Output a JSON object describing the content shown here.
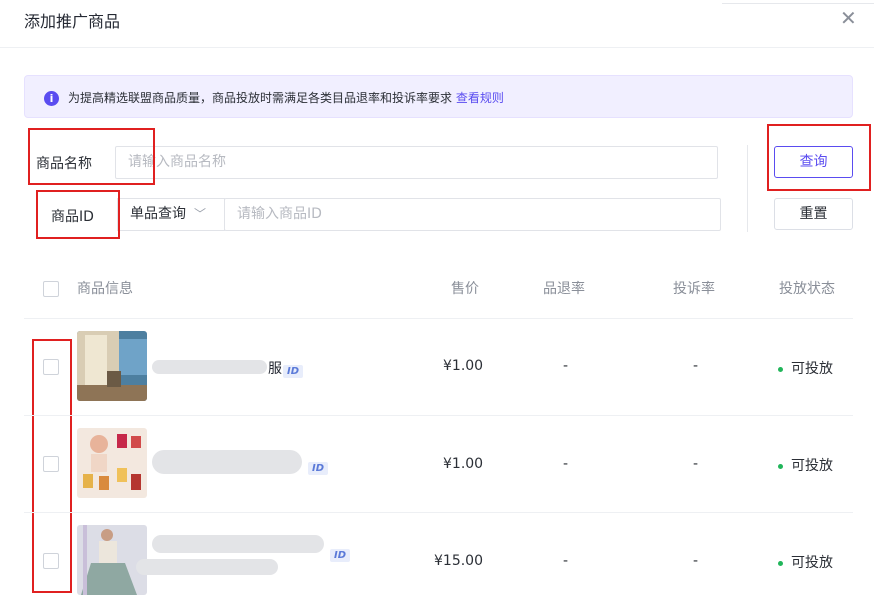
{
  "dialog": {
    "title": "添加推广商品",
    "close_icon": "close-icon"
  },
  "notice": {
    "icon": "info-icon",
    "icon_glyph": "i",
    "text": "为提高精选联盟商品质量，商品投放时需满足各类目品退率和投诉率要求",
    "link": "查看规则"
  },
  "search": {
    "name_label": "商品名称",
    "name_placeholder": "请输入商品名称",
    "id_label": "商品ID",
    "id_mode": "单品查询",
    "id_placeholder": "请输入商品ID",
    "query_button": "查询",
    "reset_button": "重置"
  },
  "table": {
    "columns": [
      "商品信息",
      "售价",
      "品退率",
      "投诉率",
      "投放状态"
    ],
    "rows": [
      {
        "name_suffix": "服",
        "id_tag": "ID",
        "price": "¥1.00",
        "return_rate": "-",
        "complaint_rate": "-",
        "status": "可投放"
      },
      {
        "name_suffix": "",
        "id_tag": "ID",
        "price": "¥1.00",
        "return_rate": "-",
        "complaint_rate": "-",
        "status": "可投放"
      },
      {
        "name_suffix": "",
        "id_tag": "ID",
        "price": "¥15.00",
        "return_rate": "-",
        "complaint_rate": "-",
        "status": "可投放"
      }
    ]
  },
  "colors": {
    "accent": "#5a4cf0",
    "status_ok": "#21b55a",
    "annotation_red": "#e02020"
  }
}
